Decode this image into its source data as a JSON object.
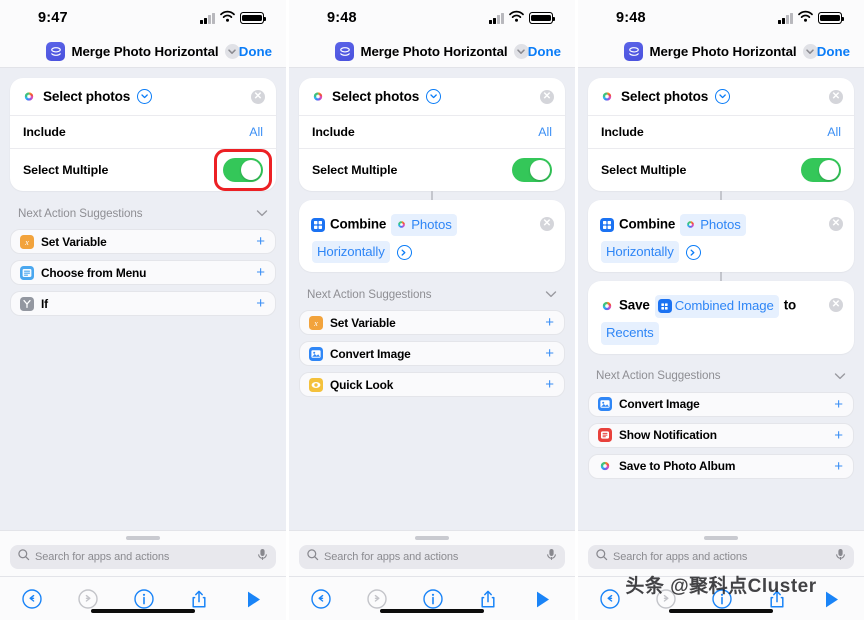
{
  "panels": [
    {
      "status": {
        "time": "9:47",
        "signal_icon": "cellular-signal-icon",
        "wifi_icon": "wifi-icon",
        "battery_icon": "battery-icon"
      },
      "nav": {
        "app_icon": "shortcuts-app-icon",
        "title": "Merge Photo Horizontal",
        "chevron_icon": "chevron-down-icon",
        "done_label": "Done"
      },
      "action_card": {
        "icon": "photos-app-icon",
        "title": "Select photos",
        "expand_icon": "chevron-down-circle-icon",
        "remove_icon": "close-circle-icon",
        "params": [
          {
            "label": "Include",
            "value": "All",
            "type": "value"
          },
          {
            "label": "Select Multiple",
            "value": "on",
            "type": "toggle",
            "highlighted": true
          }
        ]
      },
      "statements": [],
      "suggestions": {
        "header": "Next Action Suggestions",
        "collapse_icon": "chevron-down-icon",
        "items": [
          {
            "label": "Set Variable",
            "icon": "set-variable-icon",
            "add_icon": "plus-icon"
          },
          {
            "label": "Choose from Menu",
            "icon": "choose-from-menu-icon",
            "add_icon": "plus-icon"
          },
          {
            "label": "If",
            "icon": "if-icon",
            "add_icon": "plus-icon"
          }
        ]
      },
      "bottom": {
        "search_placeholder": "Search for apps and actions",
        "search_icon": "search-icon",
        "mic_icon": "microphone-icon",
        "tools": [
          "undo-icon",
          "redo-icon",
          "info-icon",
          "share-icon",
          "play-icon"
        ]
      },
      "watermark": ""
    },
    {
      "status": {
        "time": "9:48",
        "signal_icon": "cellular-signal-icon",
        "wifi_icon": "wifi-icon",
        "battery_icon": "battery-icon"
      },
      "nav": {
        "app_icon": "shortcuts-app-icon",
        "title": "Merge Photo Horizontal",
        "chevron_icon": "chevron-down-icon",
        "done_label": "Done"
      },
      "action_card": {
        "icon": "photos-app-icon",
        "title": "Select photos",
        "expand_icon": "chevron-down-circle-icon",
        "remove_icon": "close-circle-icon",
        "params": [
          {
            "label": "Include",
            "value": "All",
            "type": "value"
          },
          {
            "label": "Select Multiple",
            "value": "on",
            "type": "toggle",
            "highlighted": false
          }
        ]
      },
      "statements": [
        {
          "icon": "combine-images-icon",
          "remove_icon": "close-circle-icon",
          "parts": [
            {
              "kind": "word",
              "text": "Combine"
            },
            {
              "kind": "token",
              "text": "Photos",
              "icon": "photos-app-icon"
            },
            {
              "kind": "token",
              "text": "Horizontally",
              "icon": ""
            },
            {
              "kind": "chevron",
              "text": "",
              "icon": "chevron-right-circle-icon"
            }
          ]
        }
      ],
      "suggestions": {
        "header": "Next Action Suggestions",
        "collapse_icon": "chevron-down-icon",
        "items": [
          {
            "label": "Set Variable",
            "icon": "set-variable-icon",
            "add_icon": "plus-icon"
          },
          {
            "label": "Convert Image",
            "icon": "convert-image-icon",
            "add_icon": "plus-icon"
          },
          {
            "label": "Quick Look",
            "icon": "quick-look-icon",
            "add_icon": "plus-icon"
          }
        ]
      },
      "bottom": {
        "search_placeholder": "Search for apps and actions",
        "search_icon": "search-icon",
        "mic_icon": "microphone-icon",
        "tools": [
          "undo-icon",
          "redo-icon",
          "info-icon",
          "share-icon",
          "play-icon"
        ]
      },
      "watermark": ""
    },
    {
      "status": {
        "time": "9:48",
        "signal_icon": "cellular-signal-icon",
        "wifi_icon": "wifi-icon",
        "battery_icon": "battery-icon"
      },
      "nav": {
        "app_icon": "shortcuts-app-icon",
        "title": "Merge Photo Horizontal",
        "chevron_icon": "chevron-down-icon",
        "done_label": "Done"
      },
      "action_card": {
        "icon": "photos-app-icon",
        "title": "Select photos",
        "expand_icon": "chevron-down-circle-icon",
        "remove_icon": "close-circle-icon",
        "params": [
          {
            "label": "Include",
            "value": "All",
            "type": "value"
          },
          {
            "label": "Select Multiple",
            "value": "on",
            "type": "toggle",
            "highlighted": false
          }
        ]
      },
      "statements": [
        {
          "icon": "combine-images-icon",
          "remove_icon": "close-circle-icon",
          "parts": [
            {
              "kind": "word",
              "text": "Combine"
            },
            {
              "kind": "token",
              "text": "Photos",
              "icon": "photos-app-icon"
            },
            {
              "kind": "token",
              "text": "Horizontally",
              "icon": ""
            },
            {
              "kind": "chevron",
              "text": "",
              "icon": "chevron-right-circle-icon"
            }
          ]
        },
        {
          "icon": "photos-app-icon",
          "remove_icon": "close-circle-icon",
          "parts": [
            {
              "kind": "word",
              "text": "Save"
            },
            {
              "kind": "token",
              "text": "Combined Image",
              "icon": "combine-images-icon"
            },
            {
              "kind": "word",
              "text": "to"
            },
            {
              "kind": "token",
              "text": "Recents",
              "icon": ""
            }
          ]
        }
      ],
      "suggestions": {
        "header": "Next Action Suggestions",
        "collapse_icon": "chevron-down-icon",
        "items": [
          {
            "label": "Convert Image",
            "icon": "convert-image-icon",
            "add_icon": "plus-icon"
          },
          {
            "label": "Show Notification",
            "icon": "show-notification-icon",
            "add_icon": "plus-icon"
          },
          {
            "label": "Save to Photo Album",
            "icon": "photos-app-icon",
            "add_icon": "plus-icon"
          }
        ]
      },
      "bottom": {
        "search_placeholder": "Search for apps and actions",
        "search_icon": "search-icon",
        "mic_icon": "microphone-icon",
        "tools": [
          "undo-icon",
          "redo-icon",
          "info-icon",
          "share-icon",
          "play-icon"
        ]
      },
      "watermark": "头条 @聚科点Cluster"
    }
  ],
  "colors": {
    "accent_blue": "#0a7cf7",
    "toggle_green": "#34c759",
    "highlight_red": "#ec2024",
    "background": "#eceef4",
    "card_white": "#ffffff",
    "token_bg": "#e6f0fe"
  }
}
